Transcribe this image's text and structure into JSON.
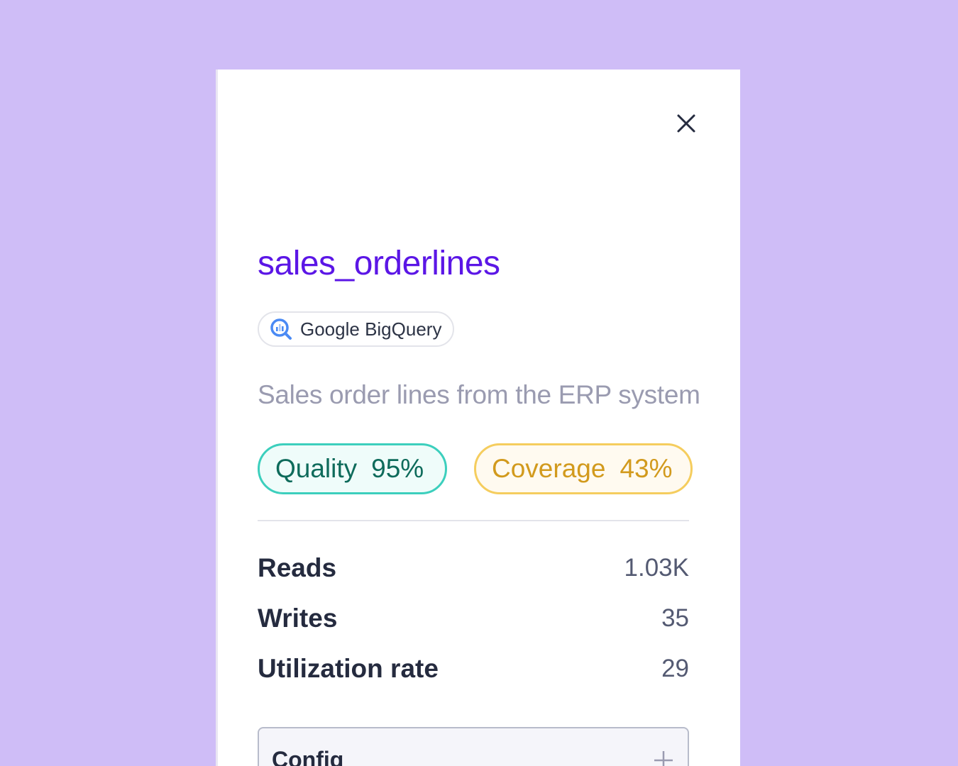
{
  "panel": {
    "title": "sales_orderlines",
    "source": {
      "label": "Google BigQuery",
      "icon": "bigquery-icon"
    },
    "description": "Sales order lines from the ERP system",
    "badges": {
      "quality": {
        "label": "Quality",
        "value": "95%",
        "color": "#3ccfbd"
      },
      "coverage": {
        "label": "Coverage",
        "value": "43%",
        "color": "#f5cd5e"
      }
    },
    "stats": [
      {
        "label": "Reads",
        "value": "1.03K"
      },
      {
        "label": "Writes",
        "value": "35"
      },
      {
        "label": "Utilization rate",
        "value": "29"
      }
    ],
    "config": {
      "label": "Config",
      "icon": "plus-icon"
    }
  },
  "colors": {
    "background": "#cfbdf7",
    "title": "#5b16e6"
  }
}
